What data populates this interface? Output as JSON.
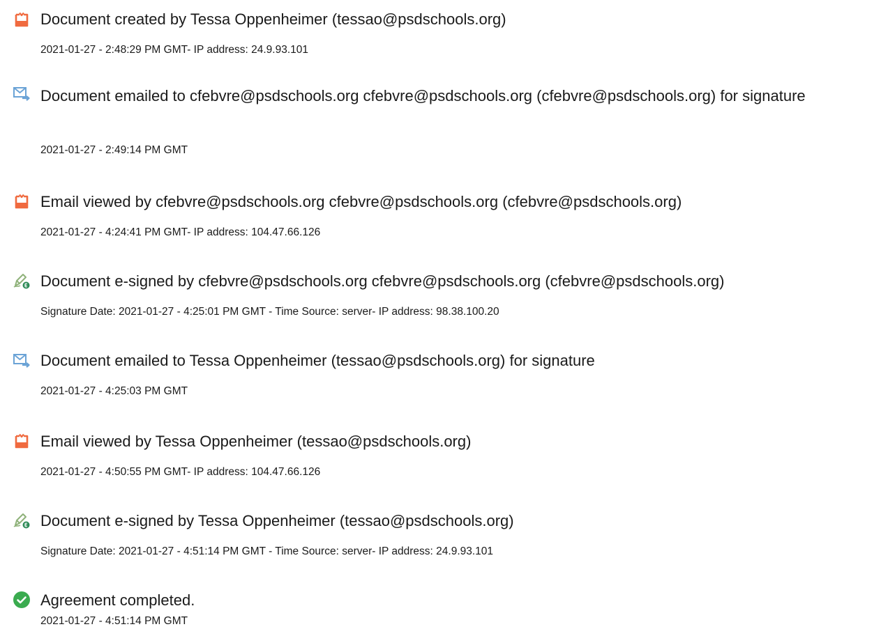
{
  "colors": {
    "doc_icon": "#f06a3f",
    "email_icon": "#6ba3d6",
    "sign_icon_pen": "#8fb27a",
    "sign_icon_badge": "#2e8b57",
    "complete_icon": "#3aab4f"
  },
  "events": [
    {
      "icon": "document-icon",
      "title": "Document created by Tessa Oppenheimer (tessao@psdschools.org)",
      "meta": "2021-01-27 - 2:48:29 PM GMT- IP address: 24.9.93.101"
    },
    {
      "icon": "email-icon",
      "title": "Document emailed to cfebvre@psdschools.org cfebvre@psdschools.org (cfebvre@psdschools.org) for signature",
      "meta": "2021-01-27 - 2:49:14 PM GMT"
    },
    {
      "icon": "document-icon",
      "title": "Email viewed by cfebvre@psdschools.org cfebvre@psdschools.org (cfebvre@psdschools.org)",
      "meta": "2021-01-27 - 4:24:41 PM GMT- IP address: 104.47.66.126"
    },
    {
      "icon": "esign-icon",
      "title": "Document e-signed by cfebvre@psdschools.org cfebvre@psdschools.org (cfebvre@psdschools.org)",
      "meta": "Signature Date: 2021-01-27 - 4:25:01 PM GMT - Time Source: server- IP address: 98.38.100.20"
    },
    {
      "icon": "email-icon",
      "title": "Document emailed to Tessa Oppenheimer (tessao@psdschools.org) for signature",
      "meta": "2021-01-27 - 4:25:03 PM GMT"
    },
    {
      "icon": "document-icon",
      "title": "Email viewed by Tessa Oppenheimer (tessao@psdschools.org)",
      "meta": "2021-01-27 - 4:50:55 PM GMT- IP address: 104.47.66.126"
    },
    {
      "icon": "esign-icon",
      "title": "Document e-signed by Tessa Oppenheimer (tessao@psdschools.org)",
      "meta": "Signature Date: 2021-01-27 - 4:51:14 PM GMT - Time Source: server- IP address: 24.9.93.101"
    },
    {
      "icon": "check-circle-icon",
      "title": "Agreement completed.",
      "meta": "2021-01-27 - 4:51:14 PM GMT"
    }
  ]
}
